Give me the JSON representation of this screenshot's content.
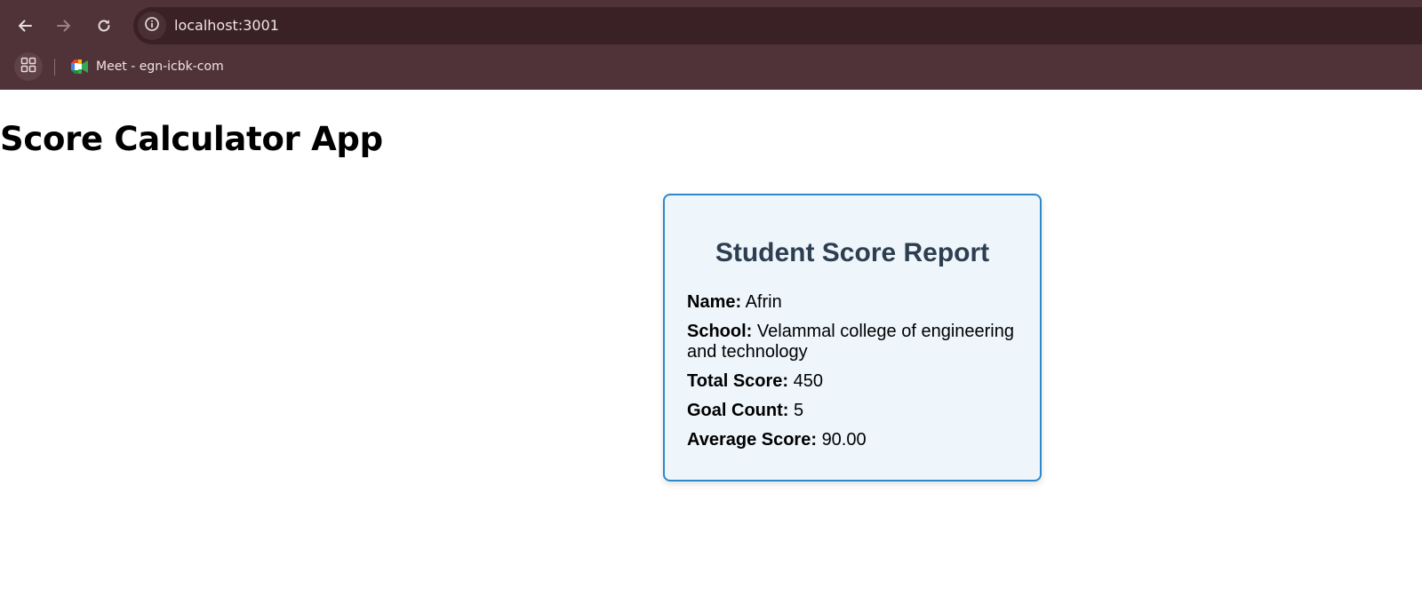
{
  "browser": {
    "url": "localhost:3001",
    "bookmarks": [
      {
        "label": "Meet - egn-icbk-com",
        "icon": "google-meet-icon"
      }
    ],
    "colors": {
      "frame": "#4f3338",
      "omnibox": "#3a2125",
      "text": "#f1e4e6"
    }
  },
  "page": {
    "title": "Score Calculator App"
  },
  "report": {
    "title": "Student Score Report",
    "fields": [
      {
        "label": "Name:",
        "value": "Afrin"
      },
      {
        "label": "School:",
        "value": "Velammal college of engineering and technology"
      },
      {
        "label": "Total Score:",
        "value": "450"
      },
      {
        "label": "Goal Count:",
        "value": "5"
      },
      {
        "label": "Average Score:",
        "value": "90.00"
      }
    ],
    "colors": {
      "border": "#2f88c9",
      "background": "#eef6fc",
      "title": "#2c3e50"
    }
  }
}
